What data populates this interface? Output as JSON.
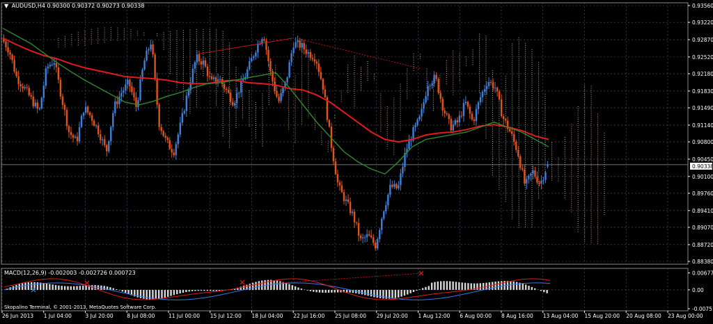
{
  "main_header": {
    "arrow": "▼",
    "text": "AUDUSD,H4  0.90300 0.90372 0.90273 0.90338"
  },
  "macd_header": {
    "text": "MACD(12,26,9) -0.002003 -0.002726 0.000723"
  },
  "copyright": "Skopalino Terminal, © 2001-2013, MetaQuotes Software Corp.",
  "current_price_label": "0.90338",
  "colors": {
    "background": "#000000",
    "grid": "#5a5a6e",
    "axis_text": "#ffffff",
    "bull_candle": "#3f7fd8",
    "bear_candle": "#e0541c",
    "ma_fast": "#2e8b2e",
    "ma_slow": "#e01c1c",
    "cloud_a": "#d9a88c",
    "cloud_b": "#c8c8c8",
    "macd_hist": "#d8d8d8",
    "macd_line": "#e01c1c",
    "signal_line": "#3a78e8",
    "divergence": "#e01c1c"
  },
  "chart_data": [
    {
      "type": "candlestick",
      "symbol": "AUDUSD",
      "timeframe": "H4",
      "last_bar": {
        "open": 0.903,
        "high": 0.90372,
        "low": 0.90273,
        "close": 0.90338
      },
      "ylim": [
        0.8838,
        0.9356
      ],
      "y_ticks": [
        "0.93560",
        "0.93220",
        "0.92870",
        "0.92520",
        "0.92180",
        "0.91830",
        "0.91490",
        "0.91140",
        "0.90800",
        "0.90450",
        "0.90100",
        "0.89760",
        "0.89410",
        "0.89070",
        "0.88720",
        "0.88380"
      ],
      "x_ticks": [
        "26 Jun 2013",
        "1 Jul 04:00",
        "3 Jul 20:00",
        "8 Jul 08:00",
        "11 Jul 00:00",
        "15 Jul 12:00",
        "18 Jul 04:00",
        "22 Jul 16:00",
        "25 Jul 08:00",
        "29 Jul 20:00",
        "1 Aug 12:00",
        "6 Aug 00:00",
        "8 Aug 16:00",
        "13 Aug 04:00",
        "15 Aug 20:00",
        "20 Aug 08:00",
        "23 Aug 00:00"
      ],
      "close_path": [
        0.929,
        0.9265,
        0.921,
        0.919,
        0.9165,
        0.914,
        0.923,
        0.9245,
        0.917,
        0.91,
        0.908,
        0.915,
        0.913,
        0.91,
        0.906,
        0.915,
        0.918,
        0.92,
        0.915,
        0.924,
        0.9285,
        0.912,
        0.908,
        0.906,
        0.912,
        0.919,
        0.925,
        0.924,
        0.92,
        0.921,
        0.9185,
        0.916,
        0.9195,
        0.923,
        0.927,
        0.93,
        0.9215,
        0.916,
        0.92,
        0.928,
        0.9275,
        0.926,
        0.925,
        0.919,
        0.908,
        0.899,
        0.896,
        0.893,
        0.888,
        0.889,
        0.887,
        0.894,
        0.899,
        0.8985,
        0.906,
        0.91,
        0.913,
        0.92,
        0.921,
        0.915,
        0.911,
        0.912,
        0.916,
        0.912,
        0.917,
        0.9205,
        0.919,
        0.913,
        0.91,
        0.906,
        0.899,
        0.902,
        0.8995,
        0.9034
      ],
      "series": [
        {
          "name": "",
          "style": "ma_slow",
          "values": [
            0.929,
            0.9277,
            0.9265,
            0.9255,
            0.9248,
            0.9238,
            0.923,
            0.9224,
            0.9218,
            0.9212,
            0.921,
            0.9208,
            0.9205,
            0.92,
            0.9198,
            0.9198,
            0.9203,
            0.9205,
            0.92,
            0.9198,
            0.9195,
            0.9188,
            0.9185,
            0.9175,
            0.916,
            0.914,
            0.912,
            0.91,
            0.9085,
            0.908,
            0.9085,
            0.9094,
            0.9098,
            0.91,
            0.9105,
            0.9112,
            0.9115,
            0.911,
            0.9103,
            0.9092,
            0.9085
          ]
        },
        {
          "name": "",
          "style": "ma_fast",
          "values": [
            0.931,
            0.9295,
            0.928,
            0.926,
            0.924,
            0.9222,
            0.9205,
            0.919,
            0.9175,
            0.916,
            0.9155,
            0.9162,
            0.9172,
            0.918,
            0.919,
            0.9198,
            0.92,
            0.9205,
            0.921,
            0.9215,
            0.922,
            0.919,
            0.9155,
            0.912,
            0.909,
            0.906,
            0.904,
            0.9025,
            0.9015,
            0.904,
            0.907,
            0.9085,
            0.909,
            0.9095,
            0.91,
            0.911,
            0.912,
            0.911,
            0.91,
            0.9085,
            0.907
          ]
        }
      ]
    },
    {
      "type": "macd",
      "params": [
        12,
        26,
        9
      ],
      "values": {
        "macd": -0.002003,
        "signal": -0.002726,
        "histogram": 0.000723
      },
      "ylim": [
        -0.00751,
        0.00774
      ],
      "y_ticks": [
        "0.006774",
        "0.00",
        "-0.00751"
      ]
    }
  ]
}
